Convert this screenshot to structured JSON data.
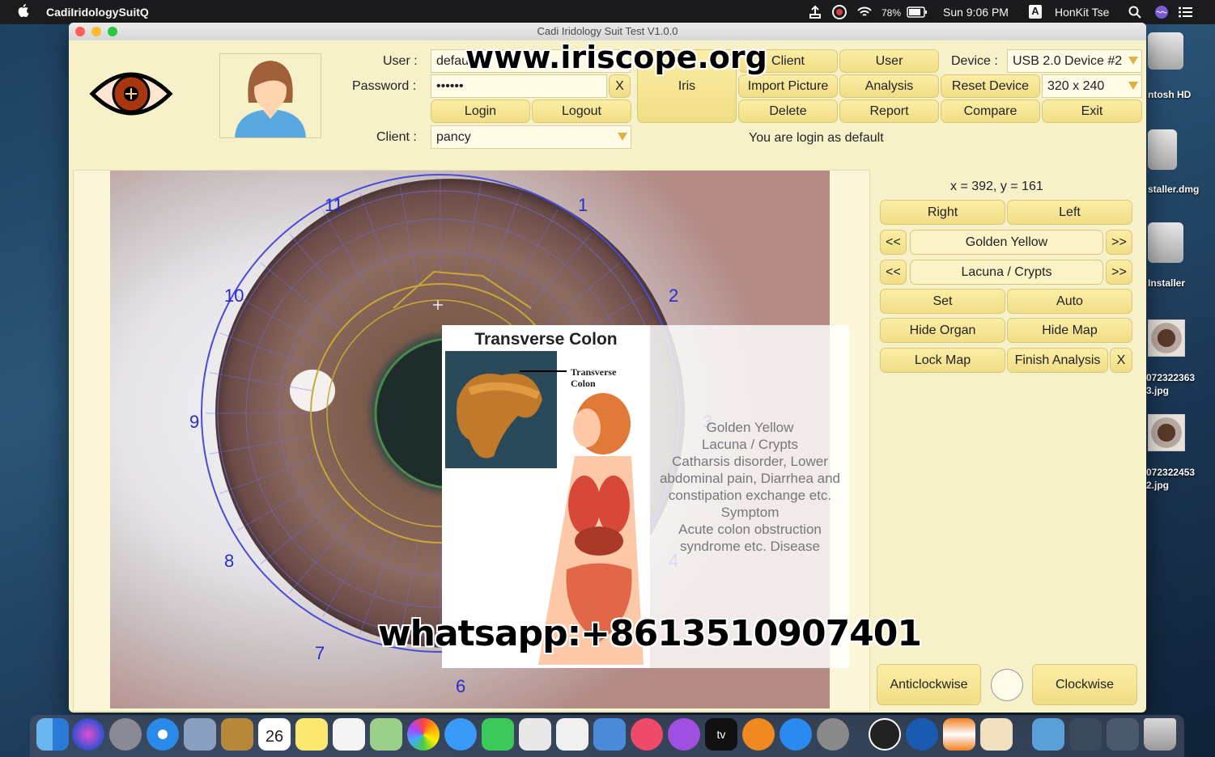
{
  "menubar": {
    "app_name": "CadiIridologySuitQ",
    "battery": "78%",
    "clock": "Sun 9:06 PM",
    "input_source": "A",
    "user": "HonKit Tse"
  },
  "desktop": {
    "items": [
      "ntosh HD",
      "staller.dmg",
      "Installer",
      "072322363\n3.jpg",
      "072322453\n2.jpg"
    ]
  },
  "window": {
    "title": "Cadi Iridology Suit Test V1.0.0",
    "login": {
      "user_label": "User :",
      "user_value": "defau",
      "password_label": "Password :",
      "password_value": "••••••",
      "clear_label": "X",
      "login_label": "Login",
      "logout_label": "Logout",
      "client_label": "Client :",
      "client_value": "pancy"
    },
    "toolbar": {
      "iris": "Iris",
      "client": "Client",
      "user": "User",
      "import_picture": "Import Picture",
      "analysis": "Analysis",
      "delete": "Delete",
      "report": "Report",
      "reset_device": "Reset Device",
      "compare": "Compare",
      "exit": "Exit",
      "device_label": "Device :",
      "device_value": "USB 2.0 Device #2",
      "resolution_value": "320 x 240",
      "status": "You are login as default"
    },
    "iris_map": {
      "clock_numbers": [
        "11",
        "1",
        "10",
        "2",
        "9",
        "3",
        "8",
        "4",
        "7",
        "6"
      ]
    },
    "popup": {
      "title": "Transverse Colon",
      "image_caption": "Transverse\nColon",
      "lines": [
        "Golden Yellow",
        "Lacuna / Crypts",
        "Catharsis disorder, Lower",
        "abdominal pain, Diarrhea and",
        "constipation exchange etc.",
        "Symptom",
        "Acute colon obstruction",
        "syndrome etc. Disease"
      ]
    },
    "controls": {
      "coords": "x = 392, y = 161",
      "right": "Right",
      "left": "Left",
      "prev": "<<",
      "next": ">>",
      "color_sign": "Golden Yellow",
      "type_sign": "Lacuna / Crypts",
      "set": "Set",
      "auto": "Auto",
      "hide_organ": "Hide Organ",
      "hide_map": "Hide Map",
      "lock_map": "Lock Map",
      "finish_analysis": "Finish Analysis",
      "close": "X",
      "anticlockwise": "Anticlockwise",
      "clockwise": "Clockwise"
    }
  },
  "watermarks": {
    "site": "www.iriscope.org",
    "whatsapp": "whatsapp:+8613510907401"
  },
  "dock": {
    "calendar_day": "26",
    "tv_label": "tv"
  },
  "colors": {
    "window_bg": "#f7f1c9",
    "button_bg": "#f5e596",
    "map_ring": "#5a5ad8",
    "zone_outline": "#c8a838"
  }
}
